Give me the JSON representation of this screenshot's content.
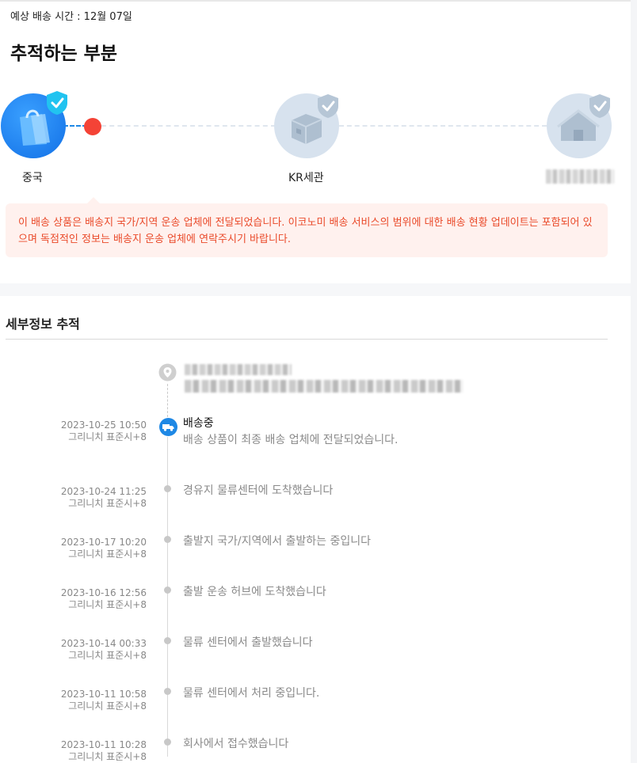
{
  "header": {
    "eta_text": "예상 배송 시간 : 12월 07일",
    "title": "추적하는 부분"
  },
  "progress": {
    "steps": [
      {
        "label": "중국",
        "icon": "shopping-bag-icon",
        "state": "done"
      },
      {
        "label": "KR세관",
        "icon": "package-box-icon",
        "state": "pending"
      },
      {
        "label": "",
        "icon": "house-icon",
        "state": "pending"
      }
    ]
  },
  "notice": {
    "text": "이 배송 상품은 배송지 국가/지역 운송 업체에 전달되었습니다. 이코노미 배송 서비스의 범위에 대한 배송 현황 업데이트는 포함되어 있으며 독점적인 정보는 배송지 운송 업체에 연락주시기 바랍니다."
  },
  "details": {
    "title": "세부정보 추적",
    "current": {
      "date": "2023-10-25 10:50",
      "tz": "그리니치 표준시+8",
      "status": "배송중",
      "desc": "배송 상품이 최종 배송 업체에 전달되었습니다."
    },
    "events": [
      {
        "date": "2023-10-24 11:25",
        "tz": "그리니치 표준시+8",
        "text": "경유지 물류센터에 도착했습니다"
      },
      {
        "date": "2023-10-17 10:20",
        "tz": "그리니치 표준시+8",
        "text": "출발지 국가/지역에서 출발하는 중입니다"
      },
      {
        "date": "2023-10-16 12:56",
        "tz": "그리니치 표준시+8",
        "text": "출발 운송 허브에 도착했습니다"
      },
      {
        "date": "2023-10-14 00:33",
        "tz": "그리니치 표준시+8",
        "text": "물류 센터에서 출발했습니다"
      },
      {
        "date": "2023-10-11 10:58",
        "tz": "그리니치 표준시+8",
        "text": "물류 센터에서 처리 중입니다."
      },
      {
        "date": "2023-10-11 10:28",
        "tz": "그리니치 표준시+8",
        "text": "회사에서 접수했습니다"
      }
    ]
  },
  "colors": {
    "accent": "#1e88e5",
    "alert": "#f44336",
    "notice_bg": "#fff1ee",
    "notice_text": "#ea4a2a"
  }
}
